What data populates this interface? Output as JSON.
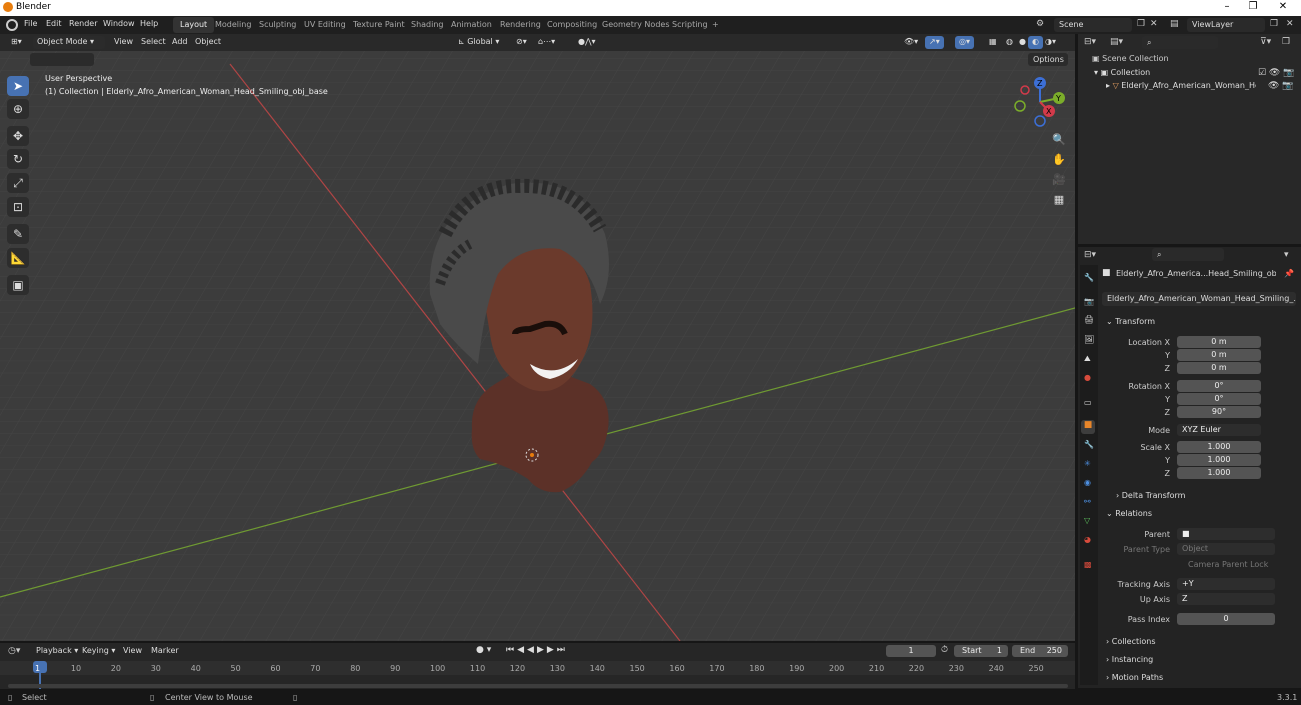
{
  "window": {
    "title": "Blender",
    "minimize": "–",
    "maximize": "❐",
    "close": "✕"
  },
  "menus": [
    "File",
    "Edit",
    "Render",
    "Window",
    "Help"
  ],
  "workspaces": [
    "Layout",
    "Modeling",
    "Sculpting",
    "UV Editing",
    "Texture Paint",
    "Shading",
    "Animation",
    "Rendering",
    "Compositing",
    "Geometry Nodes",
    "Scripting",
    "+"
  ],
  "scene": {
    "name": "Scene",
    "view_layer": "ViewLayer"
  },
  "viewport": {
    "mode": "Object Mode",
    "menus": [
      "View",
      "Select",
      "Add",
      "Object"
    ],
    "orientation": "Global",
    "options": "Options",
    "perspective": "User Perspective",
    "collection_info": "(1) Collection | Elderly_Afro_American_Woman_Head_Smiling_obj_base",
    "gizmo": {
      "x": "X",
      "y": "Y",
      "z": "Z"
    }
  },
  "outliner": {
    "search_placeholder": "",
    "scene_collection": "Scene Collection",
    "collection": "Collection",
    "object": "Elderly_Afro_American_Woman_Hea"
  },
  "properties": {
    "search_placeholder": "",
    "object_name": "Elderly_Afro_America...Head_Smiling_obj_bas",
    "object_data": "Elderly_Afro_American_Woman_Head_Smiling_...",
    "transform": {
      "title": "Transform",
      "location_label": "Location X",
      "y": "Y",
      "z": "Z",
      "loc": [
        "0 m",
        "0 m",
        "0 m"
      ],
      "rotation_label": "Rotation X",
      "rot": [
        "0°",
        "0°",
        "90°"
      ],
      "mode_label": "Mode",
      "mode": "XYZ Euler",
      "scale_label": "Scale X",
      "scale": [
        "1.000",
        "1.000",
        "1.000"
      ]
    },
    "delta": "Delta Transform",
    "relations": {
      "title": "Relations",
      "parent": "Parent",
      "parent_type": "Parent Type",
      "parent_type_value": "Object",
      "camera_parent_lock": "Camera Parent Lock",
      "tracking_axis": "Tracking Axis",
      "tracking_value": "+Y",
      "up_axis": "Up Axis",
      "up_value": "Z",
      "pass_index": "Pass Index",
      "pass_value": "0"
    },
    "collections": "Collections",
    "instancing": "Instancing",
    "motion_paths": "Motion Paths"
  },
  "timeline": {
    "menus": [
      "Playback",
      "Keying",
      "View",
      "Marker"
    ],
    "current_frame": "1",
    "start_label": "Start",
    "start": "1",
    "end_label": "End",
    "end": "250",
    "ticks": [
      "1",
      "10",
      "20",
      "30",
      "40",
      "50",
      "60",
      "70",
      "80",
      "90",
      "100",
      "110",
      "120",
      "130",
      "140",
      "150",
      "160",
      "170",
      "180",
      "190",
      "200",
      "210",
      "220",
      "230",
      "240",
      "250"
    ]
  },
  "status": {
    "select": "Select",
    "center": "Center View to Mouse",
    "version": "3.3.1"
  }
}
